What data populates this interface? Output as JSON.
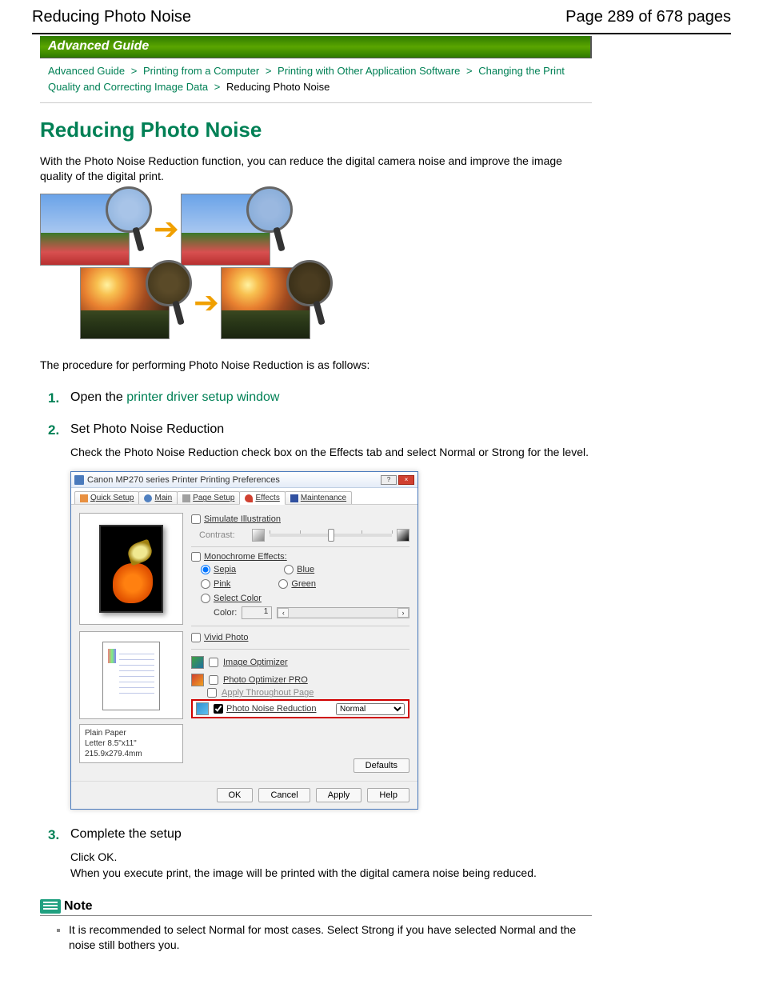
{
  "header": {
    "left": "Reducing Photo Noise",
    "right": "Page 289 of 678 pages"
  },
  "banner": "Advanced Guide",
  "breadcrumb": {
    "items": [
      "Advanced Guide",
      "Printing from a Computer",
      "Printing with Other Application Software",
      "Changing the Print Quality and Correcting Image Data"
    ],
    "current": "Reducing Photo Noise",
    "sep": ">"
  },
  "title": "Reducing Photo Noise",
  "intro": "With the Photo Noise Reduction function, you can reduce the digital camera noise and improve the image quality of the digital print.",
  "proc_intro": "The procedure for performing Photo Noise Reduction is as follows:",
  "steps": {
    "s1": {
      "num": "1.",
      "pre": "Open the ",
      "link": "printer driver setup window"
    },
    "s2": {
      "num": "2.",
      "title": "Set Photo Noise Reduction",
      "body": "Check the Photo Noise Reduction check box on the Effects tab and select Normal or Strong for the level."
    },
    "s3": {
      "num": "3.",
      "title": "Complete the setup",
      "body1": "Click OK.",
      "body2": "When you execute print, the image will be printed with the digital camera noise being reduced."
    }
  },
  "dialog": {
    "title": "Canon MP270 series Printer Printing Preferences",
    "closebtn": "×",
    "helpbtn": "?",
    "tabs": {
      "quick": "Quick Setup",
      "main": "Main",
      "pagesetup": "Page Setup",
      "effects": "Effects",
      "maint": "Maintenance"
    },
    "simulate": "Simulate Illustration",
    "contrast": "Contrast:",
    "mono_label": "Monochrome Effects:",
    "mono": {
      "sepia": "Sepia",
      "blue": "Blue",
      "pink": "Pink",
      "green": "Green",
      "select": "Select Color",
      "color": "Color:",
      "color_val": "1"
    },
    "vivid": "Vivid Photo",
    "imgopt": "Image Optimizer",
    "imgoptpro": "Photo Optimizer PRO",
    "applythru": "Apply Throughout Page",
    "pnr": "Photo Noise Reduction",
    "pnr_level": "Normal",
    "media": {
      "l1": "Plain Paper",
      "l2": "Letter 8.5\"x11\" 215.9x279.4mm"
    },
    "defaults": "Defaults",
    "ok": "OK",
    "cancel": "Cancel",
    "apply": "Apply",
    "help": "Help"
  },
  "note": {
    "title": "Note",
    "item": "It is recommended to select Normal for most cases. Select Strong if you have selected Normal and the noise still bothers you."
  }
}
